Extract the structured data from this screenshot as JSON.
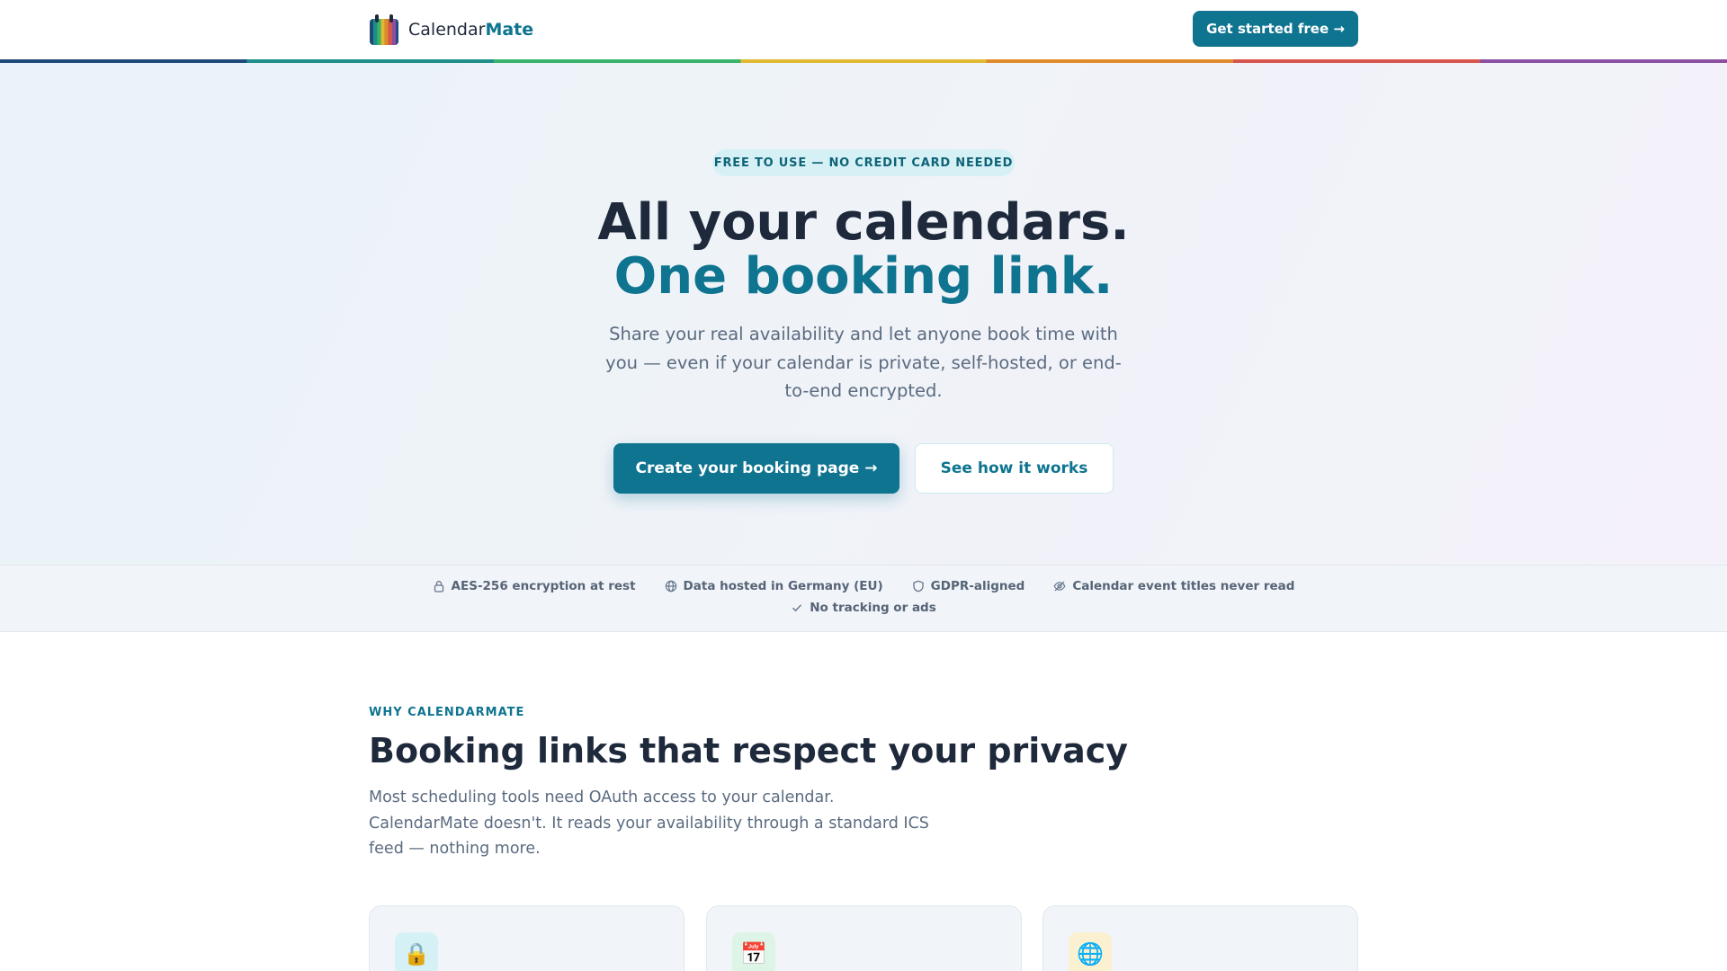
{
  "header": {
    "brand_name": "Calendar",
    "brand_accent": "Mate",
    "cta_label": "Get started free →"
  },
  "hero": {
    "badge": "FREE TO USE — NO CREDIT CARD NEEDED",
    "title_line1": "All your calendars.",
    "title_line2": "One booking link.",
    "subtitle": "Share your real availability and let anyone book time with you — even if your calendar is private, self-hosted, or end-to-end encrypted.",
    "primary_button": "Create your booking page →",
    "secondary_button": "See how it works"
  },
  "trust": {
    "items": [
      {
        "label": "AES-256 encryption at rest",
        "icon": "lock-icon"
      },
      {
        "label": "Data hosted in Germany (EU)",
        "icon": "globe-icon"
      },
      {
        "label": "GDPR-aligned",
        "icon": "shield-icon"
      },
      {
        "label": "Calendar event titles never read",
        "icon": "eye-off-icon"
      },
      {
        "label": "No tracking or ads",
        "icon": "check-icon"
      }
    ]
  },
  "why": {
    "eyebrow": "WHY CALENDARMATE",
    "title": "Booking links that respect your privacy",
    "description": "Most scheduling tools need OAuth access to your calendar. CalendarMate doesn't. It reads your availability through a standard ICS feed — nothing more."
  },
  "cards": [
    {
      "icon": "lock-icon",
      "glyph": "🔒",
      "bg": "#d6f1f6"
    },
    {
      "icon": "calendar-icon",
      "glyph": "📅",
      "bg": "#dcf5e6"
    },
    {
      "icon": "globe-icon",
      "glyph": "🌐",
      "bg": "#fbf0cf"
    }
  ],
  "colors": {
    "accent": "#0e7490",
    "text": "#1e293b",
    "muted": "#5b6b80"
  }
}
